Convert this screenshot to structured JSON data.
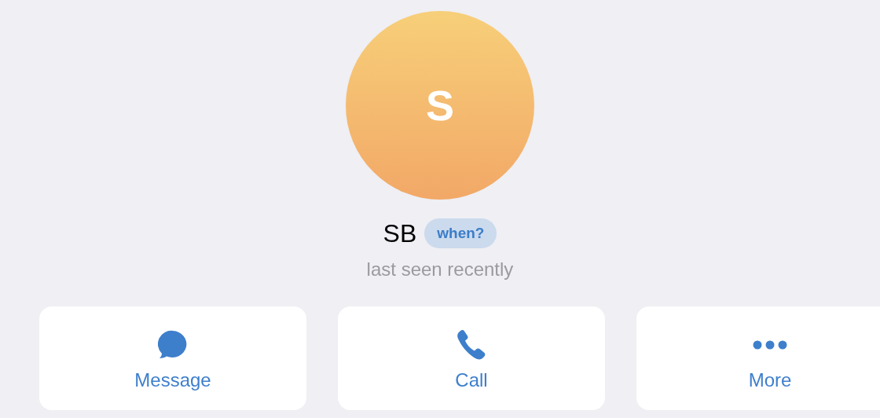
{
  "profile": {
    "avatar_initial": "S",
    "name": "SB",
    "badge": "when?",
    "status": "last seen recently"
  },
  "actions": [
    {
      "kind": "message",
      "label": "Message"
    },
    {
      "kind": "call",
      "label": "Call"
    },
    {
      "kind": "more",
      "label": "More"
    }
  ]
}
